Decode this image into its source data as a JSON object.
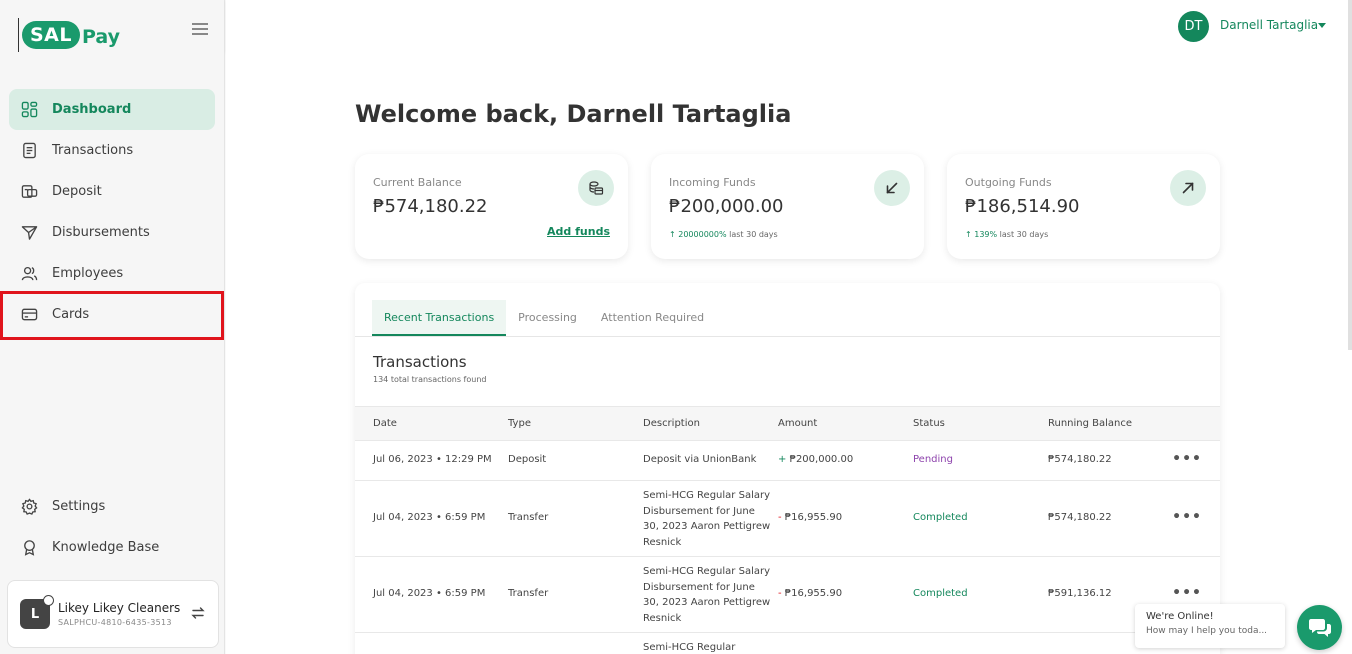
{
  "brand": {
    "logo_left": "SAL",
    "logo_right": "Pay",
    "accent": "#14875c"
  },
  "sidebar": {
    "items": [
      {
        "label": "Dashboard",
        "icon": "dashboard-icon",
        "active": true
      },
      {
        "label": "Transactions",
        "icon": "document-icon"
      },
      {
        "label": "Deposit",
        "icon": "cash-icon"
      },
      {
        "label": "Disbursements",
        "icon": "send-icon"
      },
      {
        "label": "Employees",
        "icon": "users-icon"
      },
      {
        "label": "Cards",
        "icon": "card-icon"
      }
    ],
    "bottom_items": [
      {
        "label": "Settings",
        "icon": "gear-icon"
      },
      {
        "label": "Knowledge Base",
        "icon": "award-icon"
      }
    ],
    "account": {
      "initial": "L",
      "name": "Likey Likey Cleaners",
      "id": "SALPHCU-4810-6435-3513"
    }
  },
  "header": {
    "user_initials": "DT",
    "user_name": "Darnell Tartaglia"
  },
  "main": {
    "welcome": "Welcome back, Darnell Tartaglia",
    "cards": {
      "balance": {
        "label": "Current Balance",
        "value": "₱574,180.22",
        "link": "Add funds"
      },
      "incoming": {
        "label": "Incoming Funds",
        "value": "₱200,000.00",
        "trend_value": "20000000%",
        "trend_suffix": "last 30 days"
      },
      "outgoing": {
        "label": "Outgoing Funds",
        "value": "₱186,514.90",
        "trend_value": "139%",
        "trend_suffix": "last 30 days"
      }
    },
    "tabs": [
      "Recent Transactions",
      "Processing",
      "Attention Required"
    ],
    "transactions": {
      "title": "Transactions",
      "count": "134 total transactions found",
      "columns": [
        "Date",
        "Type",
        "Description",
        "Amount",
        "Status",
        "Running Balance"
      ],
      "rows": [
        {
          "date": "Jul 06, 2023 • 12:29 PM",
          "type": "Deposit",
          "description": "Deposit via UnionBank",
          "sign": "+",
          "amount": "₱200,000.00",
          "status": "Pending",
          "balance": "₱574,180.22",
          "more": "•••"
        },
        {
          "date": "Jul 04, 2023 • 6:59 PM",
          "type": "Transfer",
          "description": "Semi-HCG Regular Salary Disbursement for June 30, 2023 Aaron Pettigrew Resnick",
          "sign": "-",
          "amount": "₱16,955.90",
          "status": "Completed",
          "balance": "₱574,180.22",
          "more": "•••"
        },
        {
          "date": "Jul 04, 2023 • 6:59 PM",
          "type": "Transfer",
          "description": "Semi-HCG Regular Salary Disbursement for June 30, 2023 Aaron Pettigrew Resnick",
          "sign": "-",
          "amount": "₱16,955.90",
          "status": "Completed",
          "balance": "₱591,136.12",
          "more": "•••"
        },
        {
          "description": "Semi-HCG Regular"
        }
      ]
    }
  },
  "chat": {
    "title": "We're Online!",
    "subtitle": "How may I help you toda..."
  }
}
